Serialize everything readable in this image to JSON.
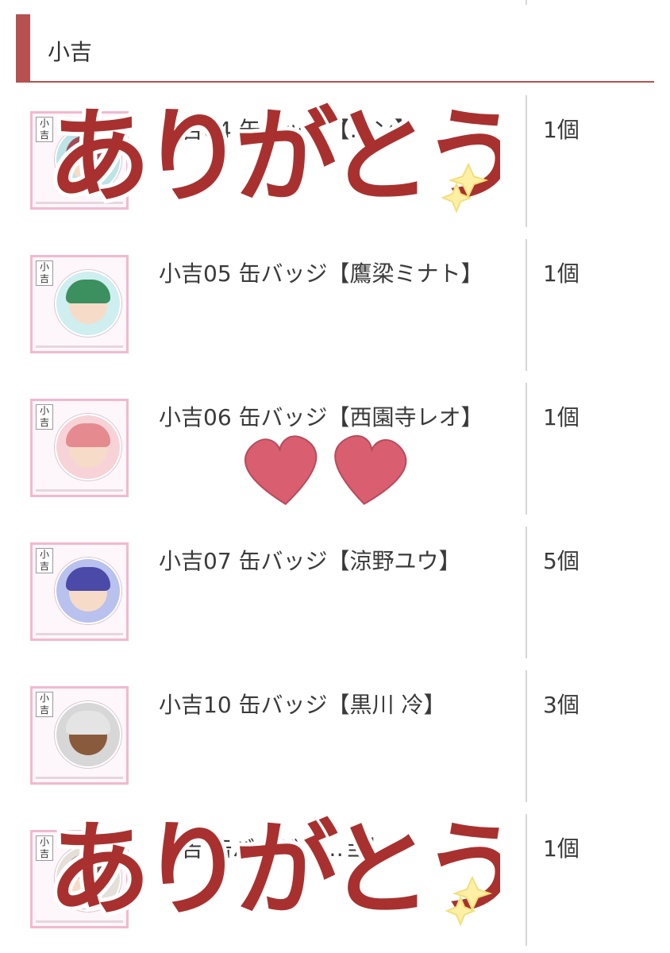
{
  "section": {
    "title": "小吉"
  },
  "items": [
    {
      "name": "小吉04 缶バッジ【…ン】",
      "qty": "1個",
      "hair": "#a34c58",
      "badge": "#bde4e6",
      "tag": "小吉"
    },
    {
      "name": "小吉05 缶バッジ【鷹梁ミナト】",
      "qty": "1個",
      "hair": "#3c8f5e",
      "badge": "#cfeef0",
      "tag": "小吉"
    },
    {
      "name": "小吉06 缶バッジ【西園寺レオ】",
      "qty": "1個",
      "hair": "#e58b8f",
      "badge": "#f7d3d8",
      "tag": "小吉"
    },
    {
      "name": "小吉07 缶バッジ【涼野ユウ】",
      "qty": "5個",
      "hair": "#4b4aa8",
      "badge": "#b9c1ee",
      "tag": "小吉"
    },
    {
      "name": "小吉10 缶バッジ【黒川 冷】",
      "qty": "3個",
      "hair": "#e4e4e4",
      "badge": "#d7d7d7",
      "tag": "小吉"
    },
    {
      "name": "小吉 缶バッジ【…ョ】",
      "qty": "1個",
      "hair": "#6d5a52",
      "badge": "#e5dfda",
      "tag": "小吉"
    }
  ],
  "stickers": {
    "thanks_text": "ありがとう",
    "color": "#a8312f"
  }
}
